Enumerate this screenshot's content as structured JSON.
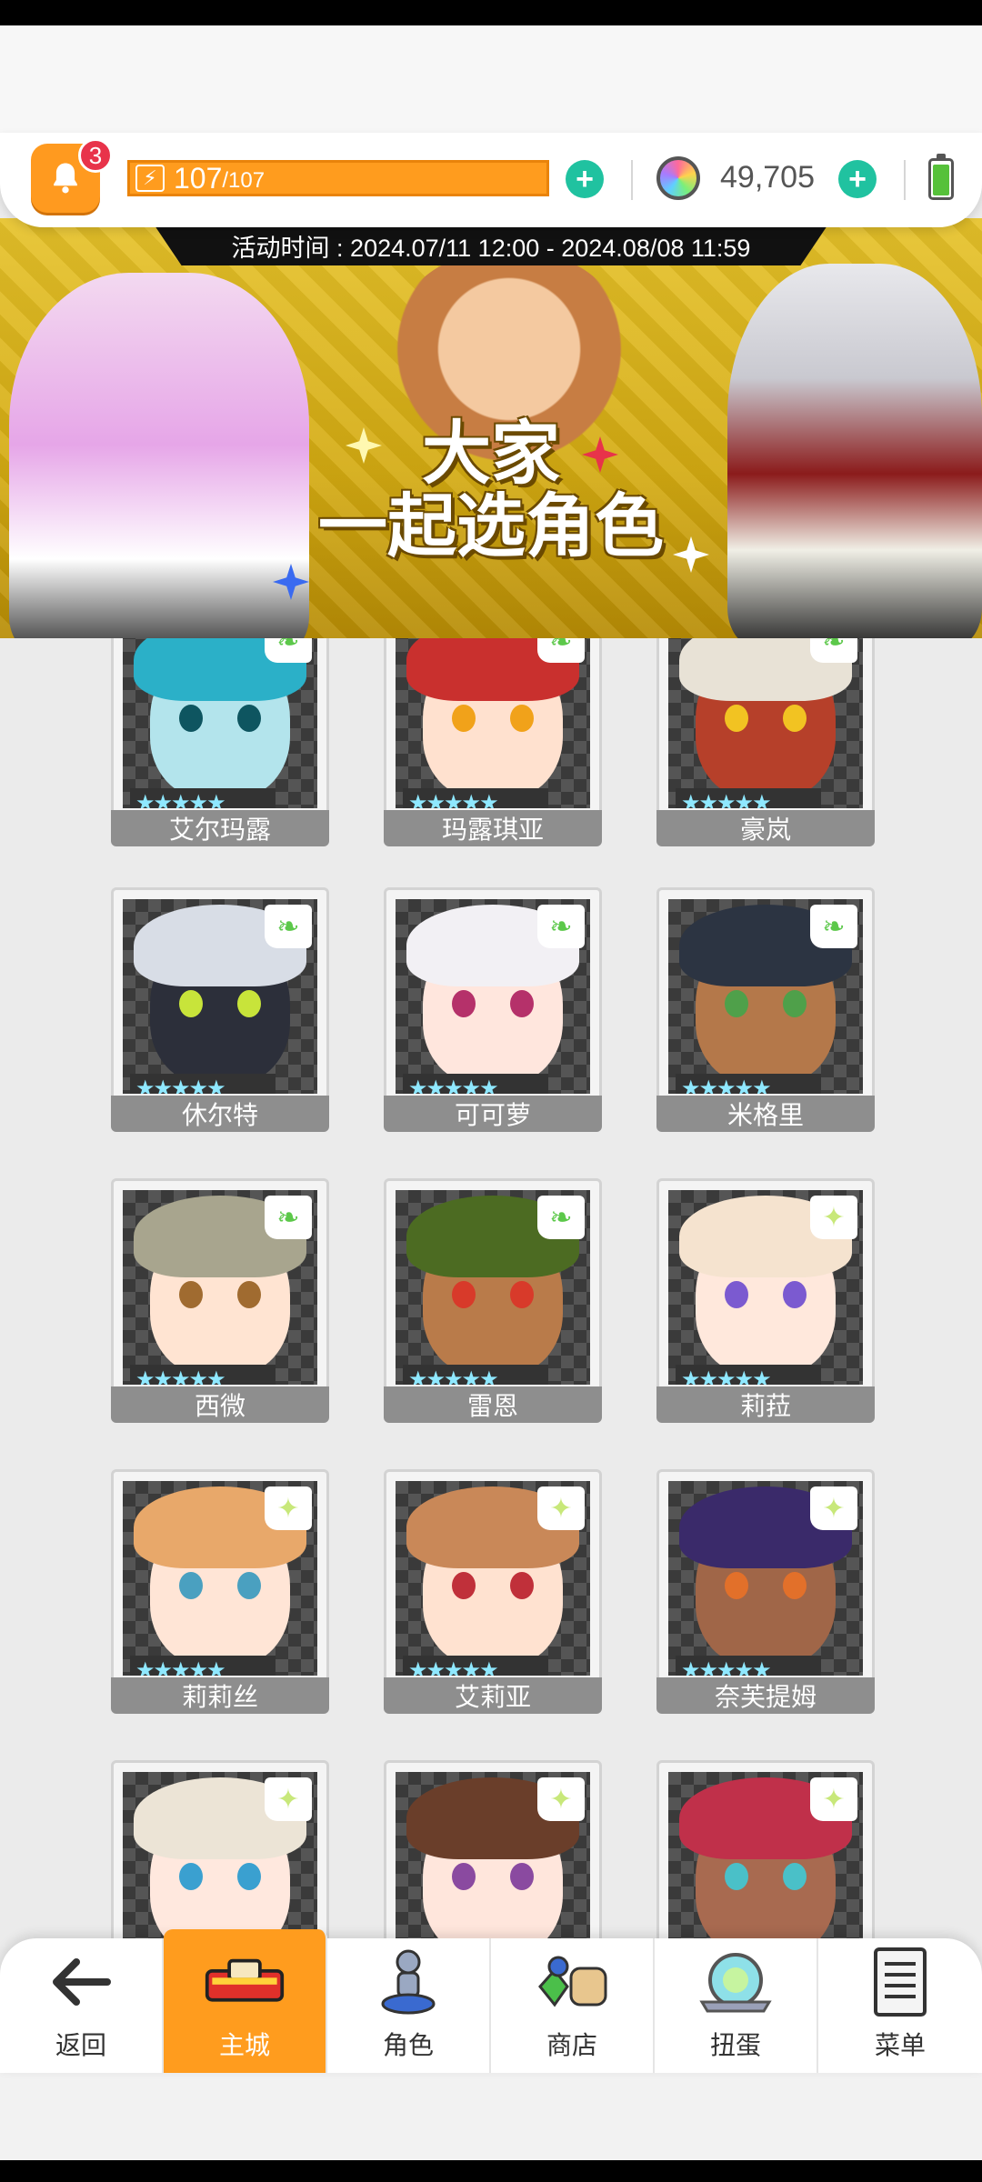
{
  "notifications": {
    "badge_count": "3",
    "icon": "bell-icon"
  },
  "stamina": {
    "current": "107",
    "max": "/107",
    "icon": "lightning-icon",
    "fill_fraction": 1.0
  },
  "gems": {
    "count": "49,705",
    "icon": "gem-icon"
  },
  "battery": {
    "icon": "battery-icon"
  },
  "banner": {
    "event_time": "活动时间 : 2024.07/11 12:00 - 2024.08/08 11:59",
    "title_line1": "大家",
    "title_line2": "一起选角色"
  },
  "characters": [
    {
      "name": "艾尔玛露",
      "stars": "★★★★★",
      "tag": "leaf",
      "hair": "#2bb0c8",
      "skin": "#b3e4ec",
      "eye": "#0e5560"
    },
    {
      "name": "玛露琪亚",
      "stars": "★★★★★",
      "tag": "leaf",
      "hair": "#c9302e",
      "skin": "#ffe1cf",
      "eye": "#f1a21a"
    },
    {
      "name": "豪岚",
      "stars": "★★★★★",
      "tag": "leaf",
      "hair": "#e8e2d6",
      "skin": "#b6402a",
      "eye": "#f2c322"
    },
    {
      "name": "休尔特",
      "stars": "★★★★★",
      "tag": "leaf",
      "hair": "#d8dde6",
      "skin": "#2c2f3a",
      "eye": "#c8e43a"
    },
    {
      "name": "可可萝",
      "stars": "★★★★★",
      "tag": "leaf",
      "hair": "#f2f0f4",
      "skin": "#ffe6dd",
      "eye": "#b5316a"
    },
    {
      "name": "米格里",
      "stars": "★★★★★",
      "tag": "leaf",
      "hair": "#2c3442",
      "skin": "#b4784a",
      "eye": "#4fa04a"
    },
    {
      "name": "西微",
      "stars": "★★★★★",
      "tag": "leaf",
      "hair": "#a8a58e",
      "skin": "#ffe4d2",
      "eye": "#a06b30"
    },
    {
      "name": "雷恩",
      "stars": "★★★★★",
      "tag": "leaf",
      "hair": "#4c6b22",
      "skin": "#b97b4a",
      "eye": "#d83a2a"
    },
    {
      "name": "莉菈",
      "stars": "★★★★★",
      "tag": "star",
      "hair": "#f5e3cf",
      "skin": "#ffe8dc",
      "eye": "#7b5ad0"
    },
    {
      "name": "莉莉丝",
      "stars": "★★★★★",
      "tag": "star",
      "hair": "#e8a86a",
      "skin": "#ffe5d6",
      "eye": "#4aa0c0"
    },
    {
      "name": "艾莉亚",
      "stars": "★★★★★",
      "tag": "star",
      "hair": "#c98858",
      "skin": "#ffe2d0",
      "eye": "#c0303a"
    },
    {
      "name": "奈芙提姆",
      "stars": "★★★★★",
      "tag": "star",
      "hair": "#3a2a6a",
      "skin": "#a06648",
      "eye": "#e2702a"
    },
    {
      "name": "",
      "stars": "",
      "tag": "star",
      "hair": "#ece4d6",
      "skin": "#ffe8de",
      "eye": "#3aa0d0"
    },
    {
      "name": "",
      "stars": "",
      "tag": "star",
      "hair": "#6a3e2a",
      "skin": "#ffe6dc",
      "eye": "#8a4aa0"
    },
    {
      "name": "",
      "stars": "",
      "tag": "star",
      "hair": "#c0304a",
      "skin": "#a86a50",
      "eye": "#4ac0c8"
    }
  ],
  "nav": {
    "back": "返回",
    "home": "主城",
    "characters": "角色",
    "shop": "商店",
    "gacha": "扭蛋",
    "menu": "菜单"
  },
  "colors": {
    "accent": "#ff9c1e",
    "plus": "#20c2a0",
    "banner": "#e6c22a"
  }
}
